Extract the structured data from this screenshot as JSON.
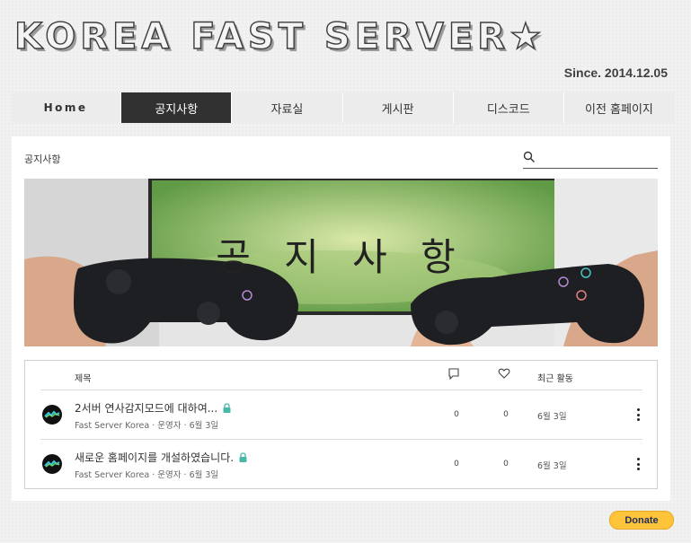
{
  "header": {
    "site_title": "KOREA FAST SERVER★",
    "since": "Since. 2014.12.05"
  },
  "nav": {
    "items": [
      {
        "label": "Home"
      },
      {
        "label": "공지사항"
      },
      {
        "label": "자료실"
      },
      {
        "label": "게시판"
      },
      {
        "label": "디스코드"
      },
      {
        "label": "이전 홈페이지"
      }
    ],
    "active_index": 1
  },
  "page": {
    "breadcrumb": "공지사항",
    "search_placeholder": "",
    "banner_title": "공 지 사 항"
  },
  "table": {
    "header_title": "제목",
    "header_activity": "최근 활동",
    "rows": [
      {
        "title": "2서버 연사감지모드에 대하여...",
        "author": "Fast Server Korea",
        "role": "운영자",
        "date": "6월 3일",
        "comments": "0",
        "likes": "0",
        "activity": "6월 3일",
        "locked": true
      },
      {
        "title": "새로운 홈페이지를 개설하였습니다.",
        "author": "Fast Server Korea",
        "role": "운영자",
        "date": "6월 3일",
        "comments": "0",
        "likes": "0",
        "activity": "6월 3일",
        "locked": true
      }
    ]
  },
  "donate": {
    "label": "Donate"
  },
  "colors": {
    "nav_active": "#313131",
    "lock": "#4ab8a8",
    "donate_bg": "#ffc439"
  }
}
